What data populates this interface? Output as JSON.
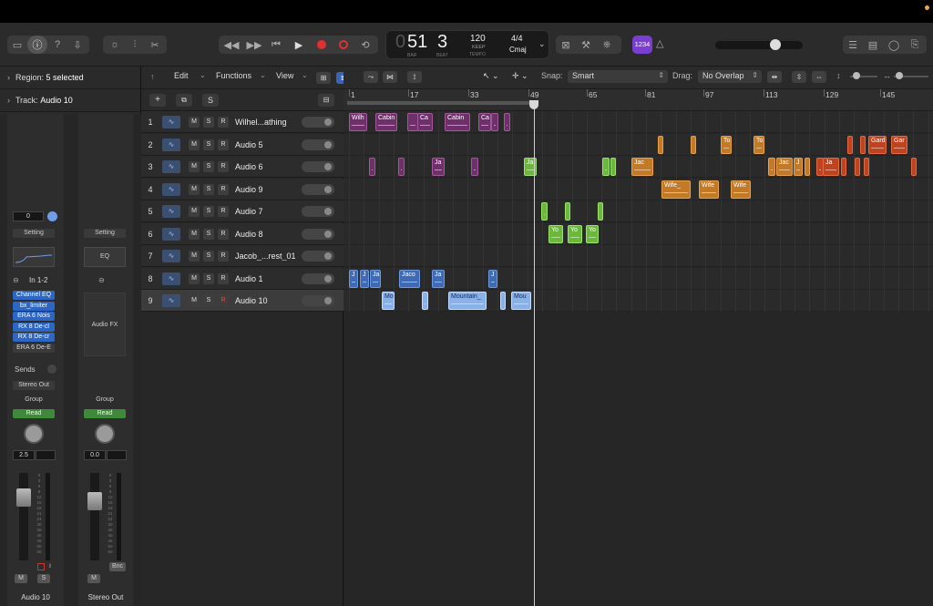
{
  "control_bar": {
    "lcd": {
      "bar": "51",
      "beat": "3",
      "bar_label": "BAR",
      "beat_label": "BEAT",
      "tempo": "120",
      "tempo_mode": "KEEP",
      "tempo_label": "TEMPO",
      "signature": "4/4",
      "key": "Cmaj"
    },
    "count_in": "1234",
    "master_volume": 0.72
  },
  "inspector": {
    "region_label": "Region:",
    "region_value": "5 selected",
    "track_label": "Track:",
    "track_value": "Audio 10",
    "strip1": {
      "pan_value": "0",
      "setting": "Setting",
      "input": "In 1-2",
      "plugins": [
        "Channel EQ",
        "bx_limiter",
        "ERA 6 Nois",
        "RX 8 De-cl",
        "RX 8 De-cr",
        "ERA 6 De-E"
      ],
      "sends": "Sends",
      "output": "Stereo Out",
      "group": "Group",
      "automation": "Read",
      "volume": "2.5",
      "mute": "M",
      "solo": "S",
      "input_monitor": "I",
      "name": "Audio 10",
      "fader_level": 0.78
    },
    "strip2": {
      "setting": "Setting",
      "eq": "EQ",
      "audio_fx": "Audio FX",
      "group": "Group",
      "automation": "Read",
      "volume": "0.0",
      "bounce": "Bnc",
      "mute": "M",
      "name": "Stereo Out",
      "fader_level": 0.72
    }
  },
  "toolbar": {
    "edit": "Edit",
    "functions": "Functions",
    "view": "View",
    "snap_label": "Snap:",
    "snap_value": "Smart",
    "drag_label": "Drag:",
    "drag_value": "No Overlap",
    "add_track": "+",
    "solo_label": "S"
  },
  "ruler": {
    "labels": [
      "1",
      "17",
      "33",
      "49",
      "65",
      "81",
      "97",
      "113",
      "129",
      "145"
    ]
  },
  "tracks": [
    {
      "num": "1",
      "name": "Wilhel...athing",
      "selected": false
    },
    {
      "num": "2",
      "name": "Audio 5",
      "selected": false
    },
    {
      "num": "3",
      "name": "Audio 6",
      "selected": false
    },
    {
      "num": "4",
      "name": "Audio 9",
      "selected": false
    },
    {
      "num": "5",
      "name": "Audio 7",
      "selected": false
    },
    {
      "num": "6",
      "name": "Audio 8",
      "selected": false
    },
    {
      "num": "7",
      "name": "Jacob_...rest_01",
      "selected": false
    },
    {
      "num": "8",
      "name": "Audio 1",
      "selected": false
    },
    {
      "num": "9",
      "name": "Audio 10",
      "selected": true
    }
  ],
  "track_buttons": {
    "mute": "M",
    "solo": "S",
    "record": "R"
  },
  "regions": {
    "track1": [
      "Wilh",
      "Cabin",
      "Ca",
      "Cabin",
      "Ca"
    ],
    "track2": [
      "To",
      "To",
      "Gard",
      "Gar"
    ],
    "track3": [
      "Ja",
      "Ja",
      "Jac",
      "Jac",
      "J",
      "Ja"
    ],
    "track4": [
      "Wife_",
      "Wife",
      "Wife"
    ],
    "track6": [
      "Yo",
      "Yo",
      "Yo"
    ],
    "track8": [
      "J",
      "J",
      "Ja",
      "Jaco",
      "Ja",
      "J"
    ],
    "track9": [
      "Mo",
      "Mountain_",
      "Mou"
    ]
  }
}
